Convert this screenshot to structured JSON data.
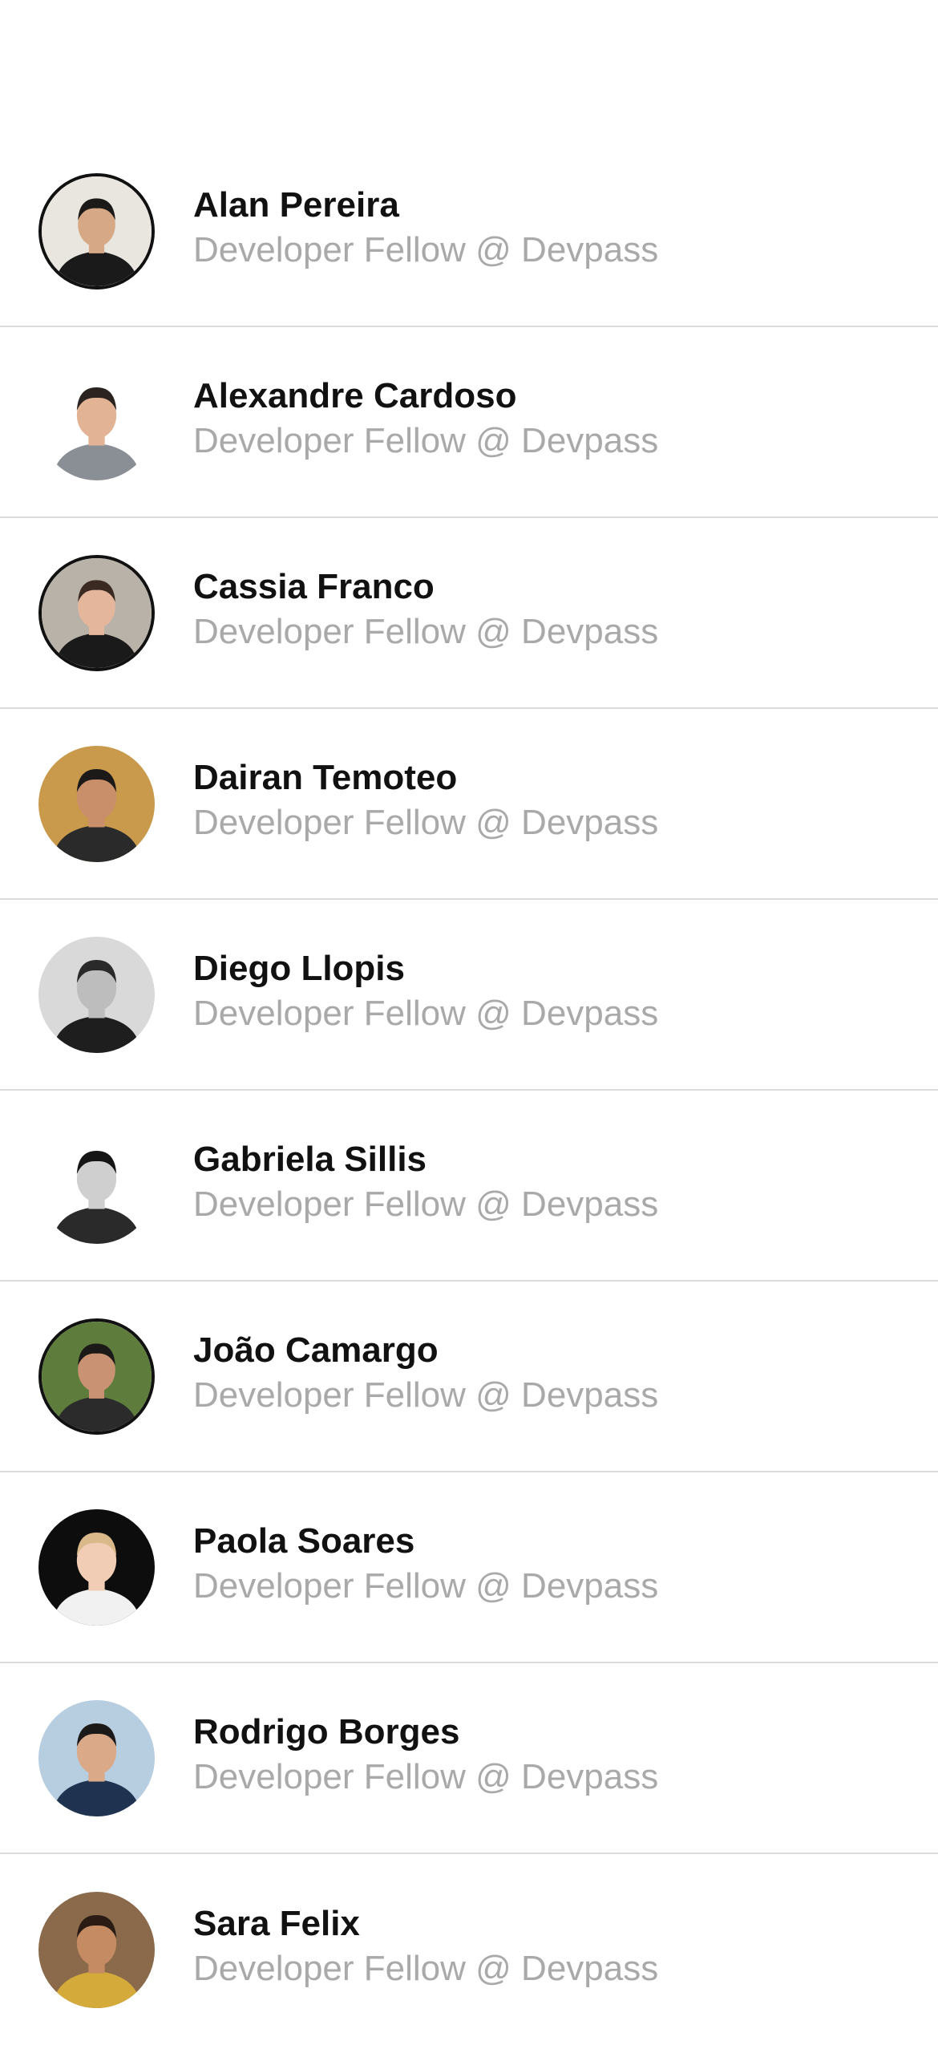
{
  "people": [
    {
      "name": "Alan Pereira",
      "role": "Developer Fellow @ Devpass",
      "bg": "#e9e6df",
      "skin": "#d7a886",
      "hair": "#1c1a18",
      "shirt": "#1a1a1a",
      "ring": true
    },
    {
      "name": "Alexandre Cardoso",
      "role": "Developer Fellow @ Devpass",
      "bg": "#ffffff",
      "skin": "#e2b394",
      "hair": "#2b2320",
      "shirt": "#8a8f96",
      "ring": false
    },
    {
      "name": "Cassia Franco",
      "role": "Developer Fellow @ Devpass",
      "bg": "#b9b2a8",
      "skin": "#e4b79c",
      "hair": "#3a2a22",
      "shirt": "#1a1a1a",
      "ring": true
    },
    {
      "name": "Dairan Temoteo",
      "role": "Developer Fellow @ Devpass",
      "bg": "#c99a4c",
      "skin": "#c98f6a",
      "hair": "#1c1a18",
      "shirt": "#2a2a2a",
      "ring": false
    },
    {
      "name": "Diego Llopis",
      "role": "Developer Fellow @ Devpass",
      "bg": "#d9d9d9",
      "skin": "#bdbdbd",
      "hair": "#2a2a2a",
      "shirt": "#1e1e1e",
      "ring": false
    },
    {
      "name": "Gabriela Sillis",
      "role": "Developer Fellow @ Devpass",
      "bg": "#ffffff",
      "skin": "#cfcfcf",
      "hair": "#151515",
      "shirt": "#2a2a2a",
      "ring": false
    },
    {
      "name": "João Camargo",
      "role": "Developer Fellow @ Devpass",
      "bg": "#5e7d3c",
      "skin": "#c99373",
      "hair": "#1c1a18",
      "shirt": "#2b2b2b",
      "ring": true
    },
    {
      "name": "Paola Soares",
      "role": "Developer Fellow @ Devpass",
      "bg": "#0d0d0d",
      "skin": "#f0cdb4",
      "hair": "#d9b98a",
      "shirt": "#f1f1f1",
      "ring": false
    },
    {
      "name": "Rodrigo Borges",
      "role": "Developer Fellow @ Devpass",
      "bg": "#b7cde0",
      "skin": "#d9a988",
      "hair": "#1c1a18",
      "shirt": "#1f3350",
      "ring": false
    },
    {
      "name": "Sara Felix",
      "role": "Developer Fellow @ Devpass",
      "bg": "#8a6a4a",
      "skin": "#c58b63",
      "hair": "#2a1c14",
      "shirt": "#d4aa3a",
      "ring": false
    }
  ]
}
